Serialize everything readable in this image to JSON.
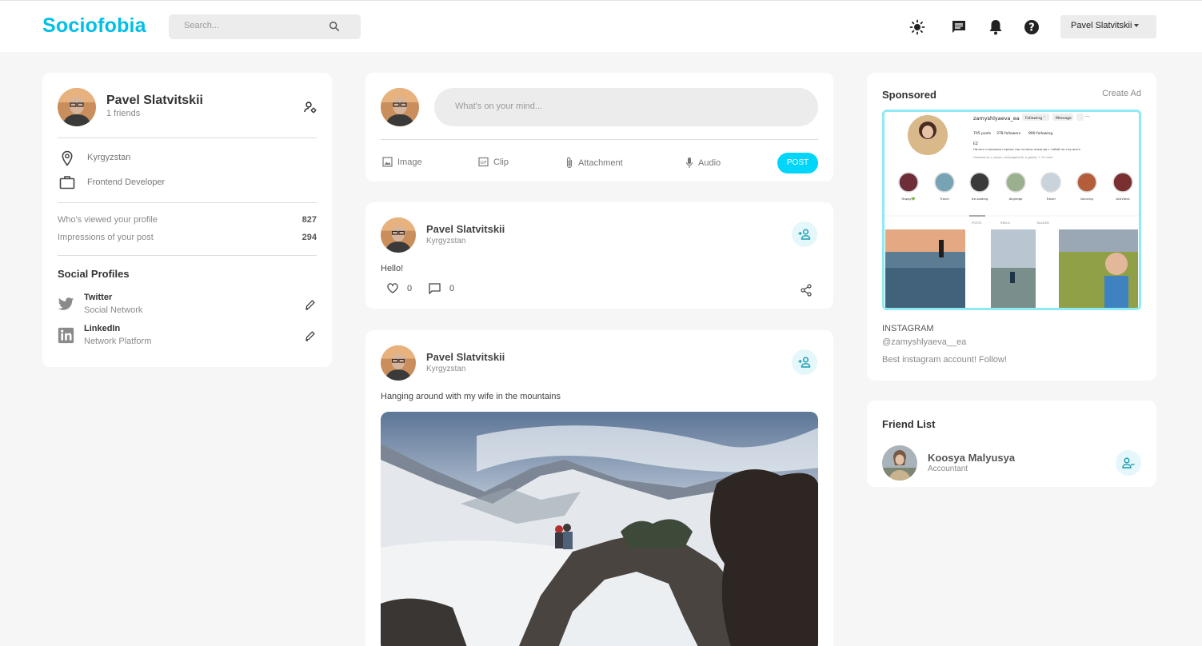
{
  "app": {
    "logo": "Sociofobia",
    "search_placeholder": "Search...",
    "user_menu_label": "Pavel Slatvitskii",
    "nav_icons": [
      "sun-icon",
      "message-icon",
      "bell-icon",
      "help-icon"
    ]
  },
  "profile": {
    "name": "Pavel Slatvitskii",
    "friends": "1 friends",
    "location": "Kyrgyzstan",
    "occupation": "Frontend Developer",
    "stats": [
      {
        "label": "Who's viewed your profile",
        "value": "827"
      },
      {
        "label": "Impressions of your post",
        "value": "294"
      }
    ],
    "social_title": "Social Profiles",
    "social": [
      {
        "name": "Twitter",
        "type": "Social Network",
        "icon": "twitter-icon"
      },
      {
        "name": "LinkedIn",
        "type": "Network Platform",
        "icon": "linkedin-icon"
      }
    ]
  },
  "composer": {
    "placeholder": "What's on your mind...",
    "actions": [
      "Image",
      "Clip",
      "Attachment",
      "Audio"
    ],
    "post_label": "POST"
  },
  "posts": [
    {
      "author": "Pavel Slatvitskii",
      "location": "Kyrgyzstan",
      "text": "Hello!",
      "likes": "0",
      "comments": "0"
    },
    {
      "author": "Pavel Slatvitskii",
      "location": "Kyrgyzstan",
      "text": "Hanging around with my wife in the mountains",
      "image": "snowy-mountains-photo"
    }
  ],
  "sponsored": {
    "title": "Sponsored",
    "create_ad": "Create Ad",
    "source": "INSTAGRAM",
    "handle": "@zamyshlyaeva__ea",
    "description": "Best instagram account! Follow!",
    "screenshot": {
      "username": "zamyshlyaeva_ea",
      "following_btn": "Following ˅",
      "message_btn": "Message",
      "posts": "705 posts",
      "followers": "378 followers",
      "following": "990 following",
      "initials": "EZ",
      "bio": "Ничего страшнее горных гор склоны никогда с тобой не случится",
      "followed_by": "Followed by y_slipov, nastyagotchik, a_gabby + 10 more",
      "highlights": [
        "Happy💚",
        "Travel",
        "Ice-skating",
        "Allgreige",
        "Travel",
        "Dancing",
        "Activities"
      ],
      "tabs": [
        "POSTS",
        "REELS",
        "TAGGED"
      ]
    }
  },
  "friend_list": {
    "title": "Friend List",
    "friends": [
      {
        "name": "Koosya Malyusya",
        "job": "Accountant"
      }
    ]
  },
  "colors": {
    "brand": "#00bfe8",
    "post_button": "#00d5fa",
    "icon_bubble": "#e4f7fb",
    "accent_teal": "#1a9bb0"
  }
}
